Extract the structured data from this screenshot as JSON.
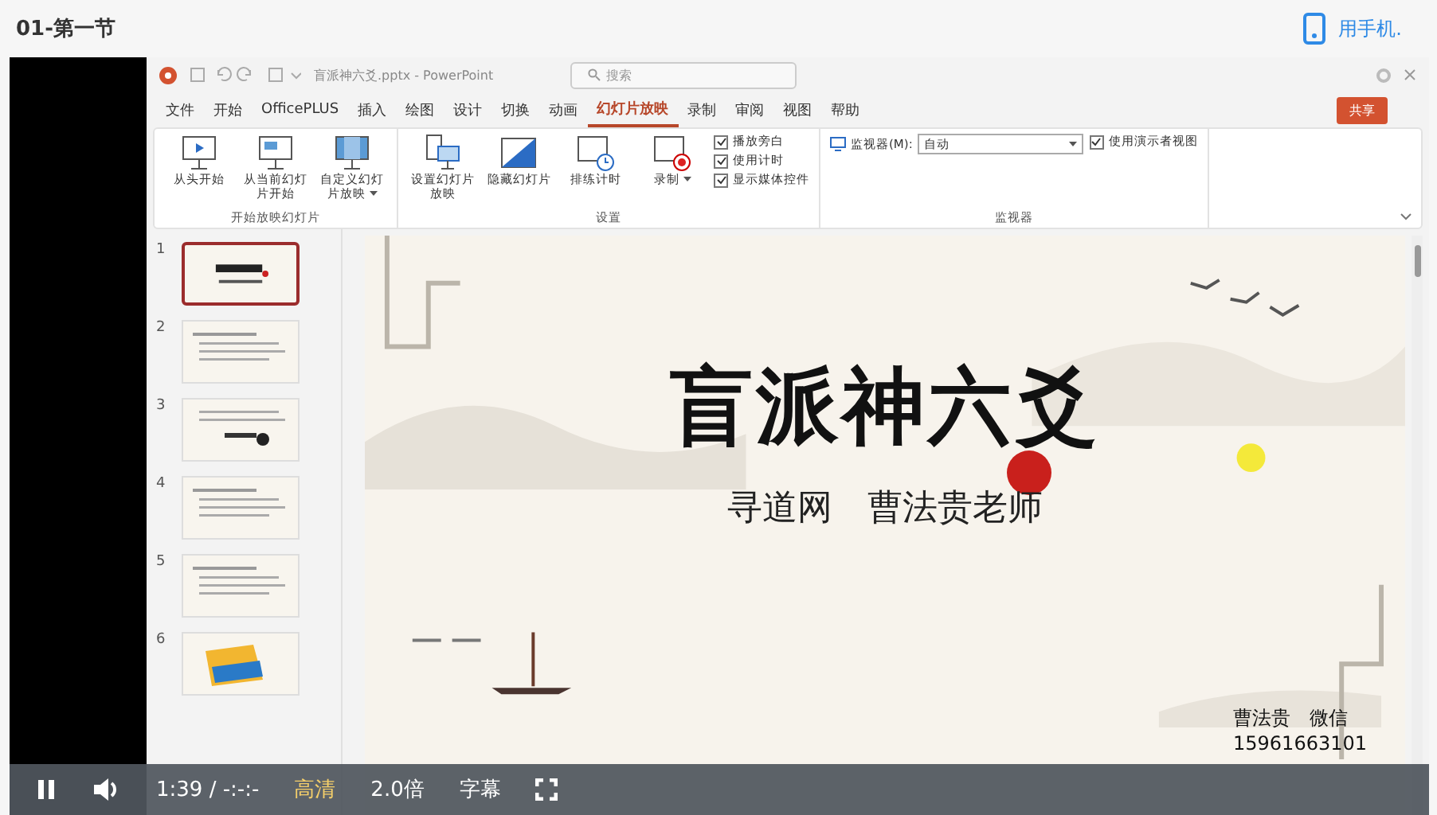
{
  "header": {
    "title": "01-第一节",
    "phone_link": "用手机."
  },
  "ppt": {
    "file_title": "盲派神六爻.pptx - PowerPoint",
    "search_placeholder": "搜索",
    "share_label": "共享",
    "menu_tabs": [
      {
        "label": "文件",
        "selected": false
      },
      {
        "label": "开始",
        "selected": false
      },
      {
        "label": "OfficePLUS",
        "selected": false
      },
      {
        "label": "插入",
        "selected": false
      },
      {
        "label": "绘图",
        "selected": false
      },
      {
        "label": "设计",
        "selected": false
      },
      {
        "label": "切换",
        "selected": false
      },
      {
        "label": "动画",
        "selected": false
      },
      {
        "label": "幻灯片放映",
        "selected": true
      },
      {
        "label": "录制",
        "selected": false
      },
      {
        "label": "审阅",
        "selected": false
      },
      {
        "label": "视图",
        "selected": false
      },
      {
        "label": "帮助",
        "selected": false
      }
    ],
    "ribbon_groups": [
      {
        "label": "开始放映幻灯片",
        "items": [
          {
            "kind": "button",
            "label": "从头开始",
            "menu": false
          },
          {
            "kind": "button",
            "label": "从当前幻灯片开始",
            "menu": false
          },
          {
            "kind": "button",
            "label": "自定义幻灯片放映",
            "menu": true
          }
        ]
      },
      {
        "label": "设置",
        "items": [
          {
            "kind": "button",
            "label": "设置幻灯片放映",
            "menu": false
          },
          {
            "kind": "button",
            "label": "隐藏幻灯片",
            "menu": false
          },
          {
            "kind": "button",
            "label": "排练计时",
            "menu": false
          },
          {
            "kind": "button",
            "label": "录制",
            "menu": true
          },
          {
            "kind": "checkboxes",
            "boxes": [
              {
                "label": "播放旁白",
                "checked": true
              },
              {
                "label": "使用计时",
                "checked": true
              },
              {
                "label": "显示媒体控件",
                "checked": true
              }
            ]
          }
        ]
      },
      {
        "label": "监视器",
        "items": [
          {
            "kind": "monitor",
            "label": "监视器(M):",
            "value": "自动"
          },
          {
            "kind": "checkboxes",
            "boxes": [
              {
                "label": "使用演示者视图",
                "checked": true
              }
            ]
          }
        ]
      }
    ],
    "thumbnails": [
      {
        "number": "1",
        "selected": true,
        "kind": "title"
      },
      {
        "number": "2",
        "selected": false,
        "kind": "text"
      },
      {
        "number": "3",
        "selected": false,
        "kind": "diagram"
      },
      {
        "number": "4",
        "selected": false,
        "kind": "text"
      },
      {
        "number": "5",
        "selected": false,
        "kind": "text"
      },
      {
        "number": "6",
        "selected": false,
        "kind": "image"
      }
    ],
    "slide": {
      "title": "盲派神六爻",
      "subtitle": "寻道网　曹法贵老师",
      "author": "曹法贵　微信",
      "phone": "15961663101"
    }
  },
  "player": {
    "time": "1:39 / -:-:-",
    "quality": "高清",
    "speed": "2.0倍",
    "subtitles": "字幕"
  }
}
